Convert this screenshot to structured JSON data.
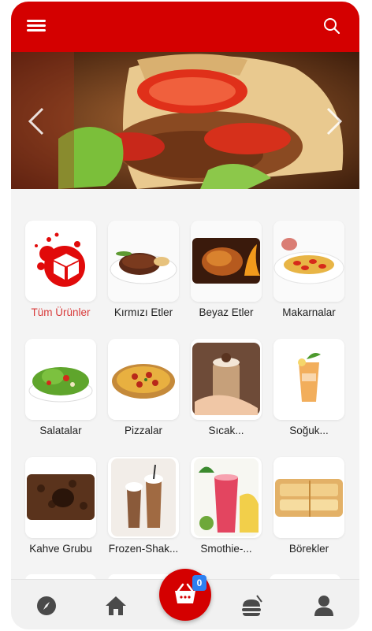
{
  "header": {
    "menu_icon": "hamburger-icon",
    "search_icon": "search-icon",
    "accent_color": "#d40000"
  },
  "banner": {
    "image": "doner-wrap-photo",
    "prev_icon": "chevron-left-icon",
    "next_icon": "chevron-right-icon"
  },
  "categories": [
    {
      "label": "Tüm Ürünler",
      "icon": "cube-splash-icon",
      "active": true
    },
    {
      "label": "Kırmızı Etler",
      "icon": "steak-photo"
    },
    {
      "label": "Beyaz Etler",
      "icon": "roast-chicken-photo"
    },
    {
      "label": "Makarnalar",
      "icon": "pasta-photo"
    },
    {
      "label": "Salatalar",
      "icon": "salad-photo"
    },
    {
      "label": "Pizzalar",
      "icon": "pizza-photo"
    },
    {
      "label": "Sıcak...",
      "icon": "hot-drink-photo"
    },
    {
      "label": "Soğuk...",
      "icon": "iced-tea-photo"
    },
    {
      "label": "Kahve Grubu",
      "icon": "coffee-beans-photo"
    },
    {
      "label": "Frozen-Shak...",
      "icon": "milkshake-photo"
    },
    {
      "label": "Smothie-...",
      "icon": "smoothie-photo"
    },
    {
      "label": "Börekler",
      "icon": "borek-photo"
    }
  ],
  "bottom_nav": {
    "items": [
      "compass-icon",
      "home-icon",
      "cart-icon",
      "food-bag-icon",
      "user-icon"
    ],
    "cart_count": "0"
  }
}
